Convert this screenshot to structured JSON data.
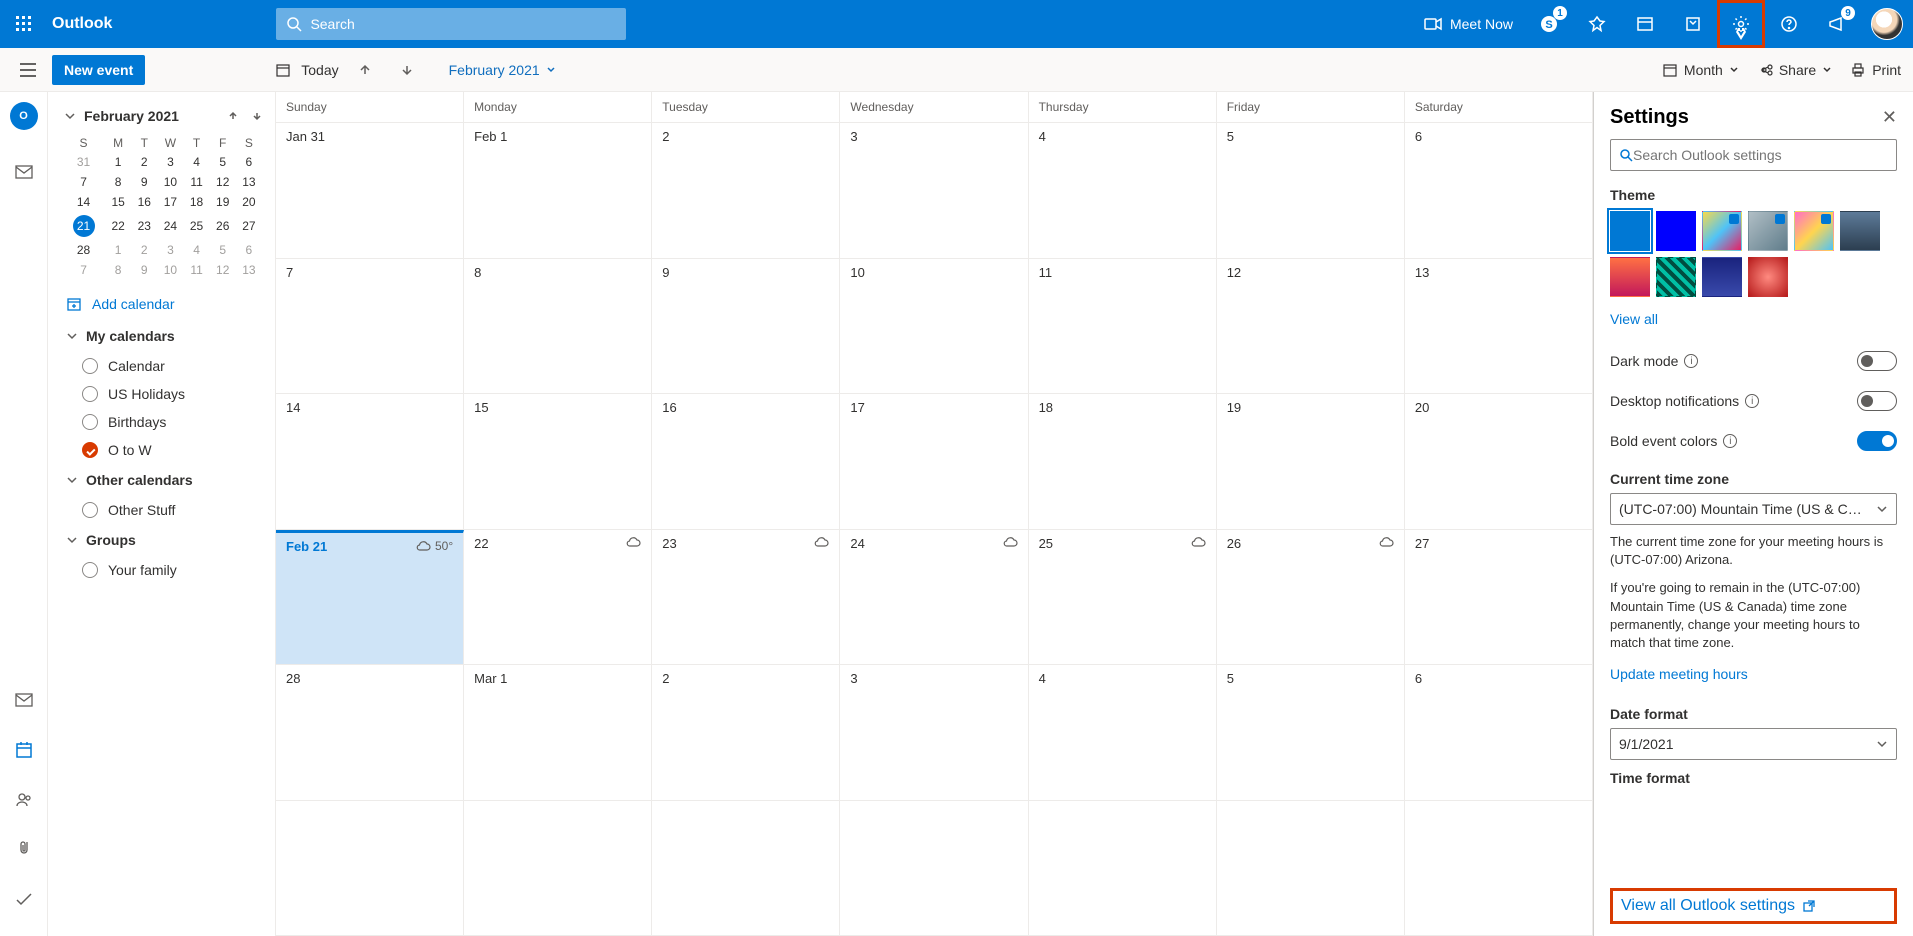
{
  "topbar": {
    "brand": "Outlook",
    "search_placeholder": "Search",
    "meet_now": "Meet Now",
    "skype_badge": "1",
    "megaphone_badge": "9"
  },
  "cmdbar": {
    "new_event": "New event",
    "today": "Today",
    "month_label": "February 2021",
    "view_label": "Month",
    "share": "Share",
    "print": "Print"
  },
  "leftpanel": {
    "mini_header": "February 2021",
    "mini_dow": [
      "S",
      "M",
      "T",
      "W",
      "T",
      "F",
      "S"
    ],
    "mini_weeks": [
      [
        {
          "d": "31",
          "other": true
        },
        {
          "d": "1"
        },
        {
          "d": "2"
        },
        {
          "d": "3"
        },
        {
          "d": "4"
        },
        {
          "d": "5"
        },
        {
          "d": "6"
        }
      ],
      [
        {
          "d": "7"
        },
        {
          "d": "8"
        },
        {
          "d": "9"
        },
        {
          "d": "10"
        },
        {
          "d": "11"
        },
        {
          "d": "12"
        },
        {
          "d": "13"
        }
      ],
      [
        {
          "d": "14"
        },
        {
          "d": "15"
        },
        {
          "d": "16"
        },
        {
          "d": "17"
        },
        {
          "d": "18"
        },
        {
          "d": "19"
        },
        {
          "d": "20"
        }
      ],
      [
        {
          "d": "21",
          "today": true
        },
        {
          "d": "22"
        },
        {
          "d": "23"
        },
        {
          "d": "24"
        },
        {
          "d": "25"
        },
        {
          "d": "26"
        },
        {
          "d": "27"
        }
      ],
      [
        {
          "d": "28"
        },
        {
          "d": "1",
          "other": true
        },
        {
          "d": "2",
          "other": true
        },
        {
          "d": "3",
          "other": true
        },
        {
          "d": "4",
          "other": true
        },
        {
          "d": "5",
          "other": true
        },
        {
          "d": "6",
          "other": true
        }
      ],
      [
        {
          "d": "7",
          "other": true
        },
        {
          "d": "8",
          "other": true
        },
        {
          "d": "9",
          "other": true
        },
        {
          "d": "10",
          "other": true
        },
        {
          "d": "11",
          "other": true
        },
        {
          "d": "12",
          "other": true
        },
        {
          "d": "13",
          "other": true
        }
      ]
    ],
    "add_calendar": "Add calendar",
    "section_my": "My calendars",
    "cals": [
      {
        "name": "Calendar",
        "checked": false
      },
      {
        "name": "US Holidays",
        "checked": false
      },
      {
        "name": "Birthdays",
        "checked": false
      },
      {
        "name": "O to W",
        "checked": true
      }
    ],
    "section_other": "Other calendars",
    "other_cals": [
      {
        "name": "Other Stuff",
        "checked": false
      }
    ],
    "section_groups": "Groups",
    "group_cals": [
      {
        "name": "Your family",
        "checked": false
      }
    ]
  },
  "grid": {
    "dow": [
      "Sunday",
      "Monday",
      "Tuesday",
      "Wednesday",
      "Thursday",
      "Friday",
      "Saturday"
    ],
    "weeks": [
      [
        {
          "date": "Jan 31"
        },
        {
          "date": "Feb 1"
        },
        {
          "date": "2"
        },
        {
          "date": "3"
        },
        {
          "date": "4"
        },
        {
          "date": "5"
        },
        {
          "date": "6"
        }
      ],
      [
        {
          "date": "7"
        },
        {
          "date": "8"
        },
        {
          "date": "9"
        },
        {
          "date": "10"
        },
        {
          "date": "11"
        },
        {
          "date": "12"
        },
        {
          "date": "13"
        }
      ],
      [
        {
          "date": "14"
        },
        {
          "date": "15"
        },
        {
          "date": "16"
        },
        {
          "date": "17"
        },
        {
          "date": "18"
        },
        {
          "date": "19"
        },
        {
          "date": "20"
        }
      ],
      [
        {
          "date": "Feb 21",
          "today": true,
          "weather": "50°"
        },
        {
          "date": "22",
          "weather": ""
        },
        {
          "date": "23",
          "weather": ""
        },
        {
          "date": "24",
          "weather": ""
        },
        {
          "date": "25",
          "weather": ""
        },
        {
          "date": "26",
          "weather": ""
        },
        {
          "date": "27"
        }
      ],
      [
        {
          "date": "28"
        },
        {
          "date": "Mar 1"
        },
        {
          "date": "2"
        },
        {
          "date": "3"
        },
        {
          "date": "4"
        },
        {
          "date": "5"
        },
        {
          "date": "6"
        }
      ],
      [
        {
          "date": ""
        },
        {
          "date": ""
        },
        {
          "date": ""
        },
        {
          "date": ""
        },
        {
          "date": ""
        },
        {
          "date": ""
        },
        {
          "date": ""
        }
      ]
    ]
  },
  "settings": {
    "title": "Settings",
    "search_placeholder": "Search Outlook settings",
    "theme_label": "Theme",
    "view_all": "View all",
    "dark_mode": "Dark mode",
    "desktop_notifications": "Desktop notifications",
    "bold_colors": "Bold event colors",
    "bold_on": true,
    "tz_label": "Current time zone",
    "tz_value": "(UTC-07:00) Mountain Time (US & C…",
    "tz_note1": "The current time zone for your meeting hours is (UTC-07:00) Arizona.",
    "tz_note2": "If you're going to remain in the (UTC-07:00) Mountain Time (US & Canada) time zone permanently, change your meeting hours to match that time zone.",
    "update_link": "Update meeting hours",
    "date_format_label": "Date format",
    "date_format_value": "9/1/2021",
    "time_format_label": "Time format",
    "footer_link": "View all Outlook settings"
  }
}
